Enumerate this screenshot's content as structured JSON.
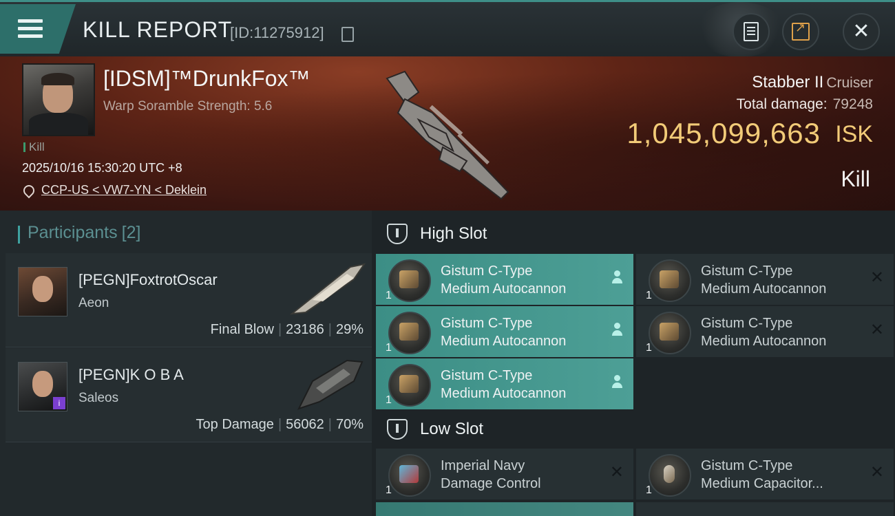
{
  "header": {
    "title": "KILL REPORT",
    "id_label": "[ID:11275912]"
  },
  "victim": {
    "name": "[IDSM]™DrunkFox™",
    "sub": "Warp Soramble Strength: 5.6",
    "kill_tag": "Kill",
    "datetime": "2025/10/16 15:30:20 UTC +8",
    "location": "CCP-US < VW7-YN < Deklein",
    "ship_name": "Stabber II",
    "ship_class": "Cruiser",
    "total_damage_label": "Total damage:",
    "total_damage_value": "79248",
    "isk_value": "1,045,099,663",
    "isk_unit": "ISK",
    "result": "Kill"
  },
  "participants": {
    "label": "Participants",
    "count": "[2]",
    "rows": [
      {
        "name": "[PEGN]FoxtrotOscar",
        "ship": "Aeon",
        "role": "Final Blow",
        "damage": "23186",
        "pct": "29%"
      },
      {
        "name": "[PEGN]K O B A",
        "ship": "Saleos",
        "role": "Top Damage",
        "damage": "56062",
        "pct": "70%"
      }
    ]
  },
  "slots": {
    "high_label": "High Slot",
    "low_label": "Low Slot",
    "high": [
      {
        "line1": "Gistum C-Type",
        "line2": "Medium Autocannon",
        "qty": "1",
        "state": "fitted"
      },
      {
        "line1": "Gistum C-Type",
        "line2": "Medium Autocannon",
        "qty": "1",
        "state": "destroyed"
      },
      {
        "line1": "Gistum C-Type",
        "line2": "Medium Autocannon",
        "qty": "1",
        "state": "fitted"
      },
      {
        "line1": "Gistum C-Type",
        "line2": "Medium Autocannon",
        "qty": "1",
        "state": "destroyed"
      },
      {
        "line1": "Gistum C-Type",
        "line2": "Medium Autocannon",
        "qty": "1",
        "state": "fitted"
      }
    ],
    "low": [
      {
        "line1": "Imperial Navy",
        "line2": "Damage Control",
        "qty": "1",
        "state": "destroyed"
      },
      {
        "line1": "Gistum C-Type",
        "line2": "Medium Capacitor...",
        "qty": "1",
        "state": "destroyed"
      }
    ]
  },
  "icons": {
    "menu": "hamburger-icon",
    "copy": "copy-icon",
    "clipboard": "clipboard-icon",
    "share": "share-icon",
    "close": "close-icon",
    "pin": "map-pin-icon",
    "pilot": "pilot-icon",
    "destroyed": "x-icon"
  },
  "colors": {
    "accent": "#3c8e85",
    "isk": "#f2cb78",
    "share": "#e0a14a"
  }
}
